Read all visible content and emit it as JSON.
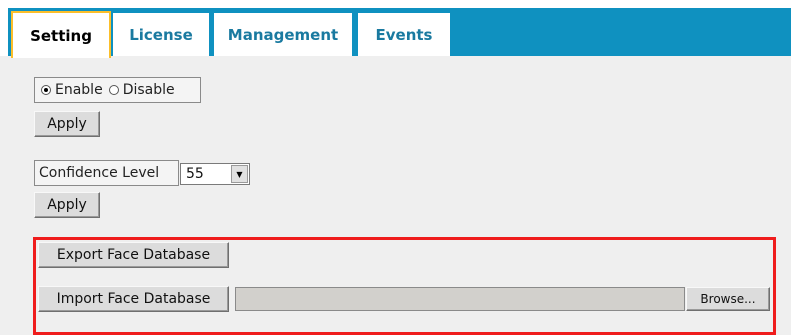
{
  "tabs": [
    {
      "label": "Setting",
      "active": true
    },
    {
      "label": "License",
      "active": false
    },
    {
      "label": "Management",
      "active": false
    },
    {
      "label": "Events",
      "active": false
    }
  ],
  "enable_group": {
    "options": [
      {
        "label": "Enable",
        "checked": true
      },
      {
        "label": "Disable",
        "checked": false
      }
    ],
    "apply_label": "Apply"
  },
  "confidence": {
    "label": "Confidence Level",
    "selected_value": "55",
    "apply_label": "Apply"
  },
  "face_db": {
    "export_label": "Export Face Database",
    "import_label": "Import Face Database",
    "file_value": "",
    "browse_label": "Browse..."
  },
  "colors": {
    "tab_bar": "#0f91c0",
    "active_tab_border": "#fcbf2a",
    "inactive_tab_text": "#1a7aa0",
    "highlight_border": "#ef1c1c",
    "background": "#efefef"
  }
}
